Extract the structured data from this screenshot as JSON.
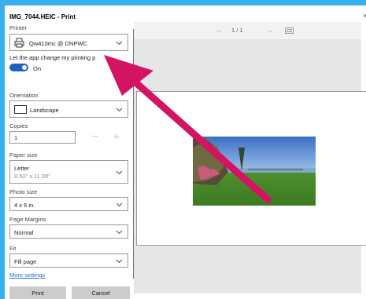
{
  "window": {
    "title": "IMG_7044.HEIC - Print",
    "close_label": "×"
  },
  "printer": {
    "label": "Printer",
    "value": "Qw410mc @ DNPWC"
  },
  "app_change": {
    "label": "Let the app change my printing p",
    "toggle_state": "On"
  },
  "orientation": {
    "label": "Orientation",
    "value": "Landscape"
  },
  "copies": {
    "label": "Copies",
    "value": "1",
    "minus": "−",
    "plus": "+"
  },
  "paper_size": {
    "label": "Paper size",
    "value": "Letter",
    "sub": "8.50\" x 11.00\""
  },
  "photo_size": {
    "label": "Photo size",
    "value": "4 x 6 in."
  },
  "page_margins": {
    "label": "Page Margins",
    "value": "Normal"
  },
  "fit": {
    "label": "Fit",
    "value": "Fill page"
  },
  "more_settings": "More settings",
  "buttons": {
    "print": "Print",
    "cancel": "Cancel"
  },
  "preview": {
    "page_counter": "1 / 1",
    "prev": "←",
    "next": "→"
  },
  "colors": {
    "accent": "#1f5fbf",
    "arrow": "#d41463",
    "background": "#39b0ec"
  }
}
